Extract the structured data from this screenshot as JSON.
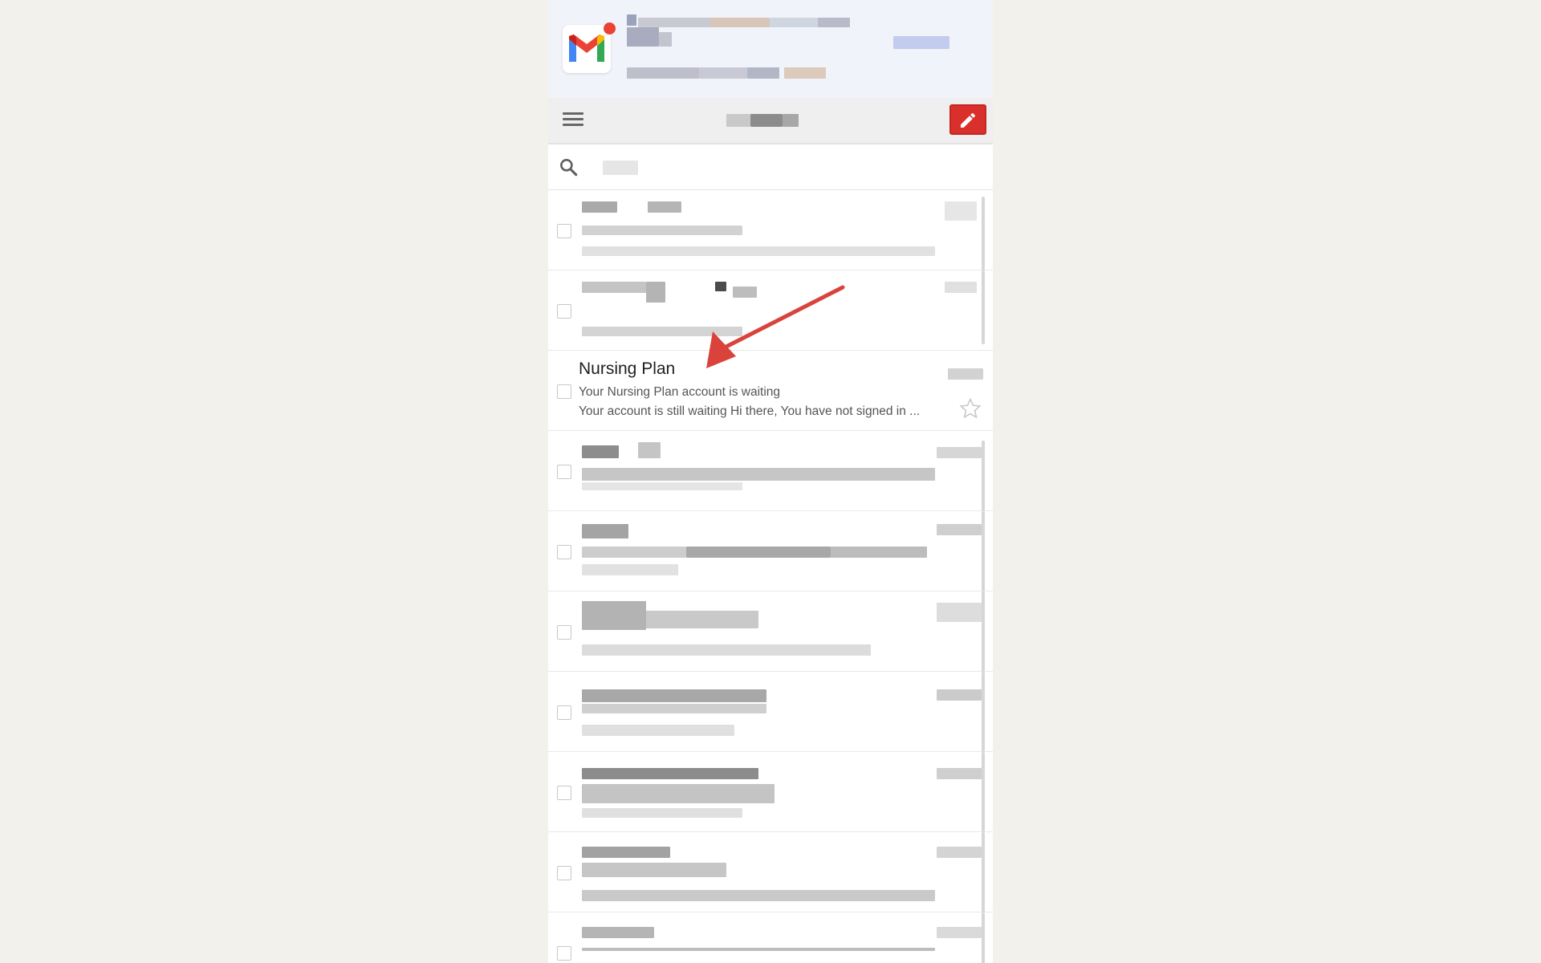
{
  "colors": {
    "page_background": "#f3f1eb",
    "header_background": "#f1f3fa",
    "compose_red": "#d9302c",
    "annotation_arrow": "#d9433b"
  },
  "icons": {
    "logo": "gmail-logo",
    "menu": "hamburger-menu-icon",
    "compose": "pencil-icon",
    "search": "search-icon",
    "star": "star-outline-icon"
  },
  "highlighted_email": {
    "sender": "Nursing Plan",
    "subject": "Your Nursing Plan account is waiting",
    "snippet": "Your account is still waiting Hi there, You have not signed in ..."
  }
}
